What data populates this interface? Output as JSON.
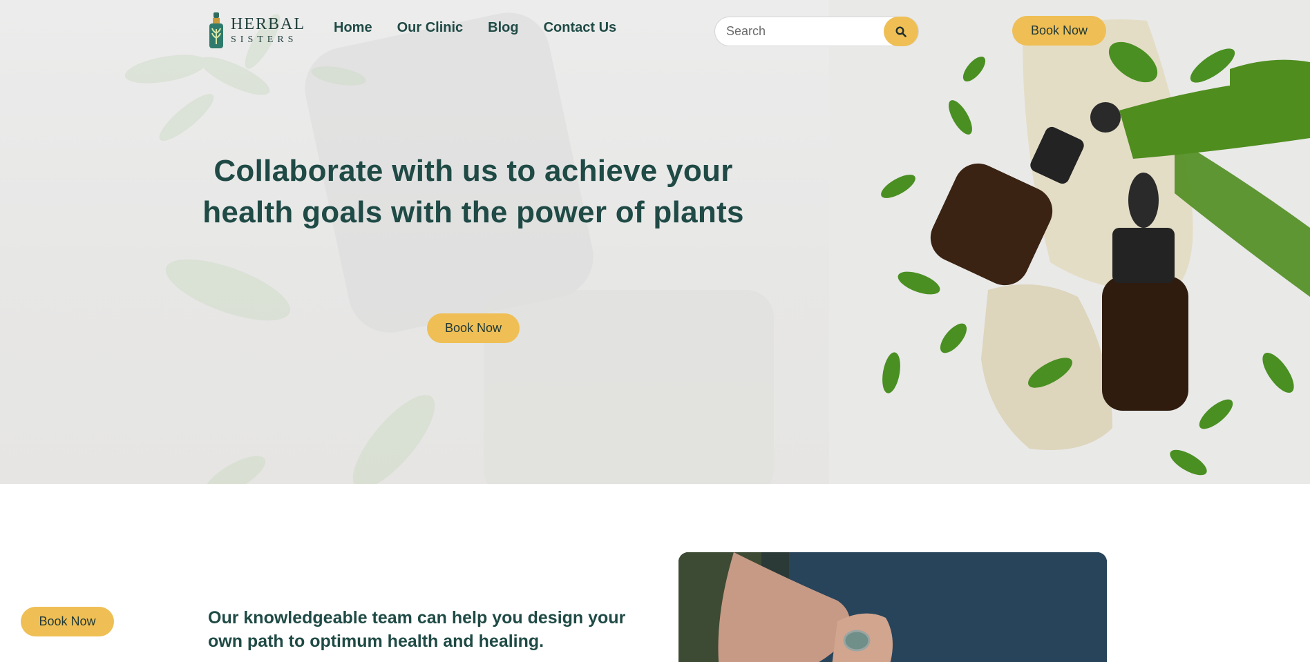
{
  "brand": {
    "name_line1": "HERBAL",
    "name_line2": "SISTERS"
  },
  "nav": {
    "items": [
      "Home",
      "Our Clinic",
      "Blog",
      "Contact Us"
    ]
  },
  "search": {
    "placeholder": "Search"
  },
  "header": {
    "book_label": "Book Now"
  },
  "hero": {
    "title": "Collaborate with us to achieve your health goals with the power of plants",
    "book_label": "Book Now"
  },
  "section2": {
    "float_book_label": "Book Now",
    "team_text": "Our knowledgeable team can help you design your own path to optimum health and healing."
  },
  "colors": {
    "accent": "#efbf55",
    "text": "#1f4a45"
  }
}
